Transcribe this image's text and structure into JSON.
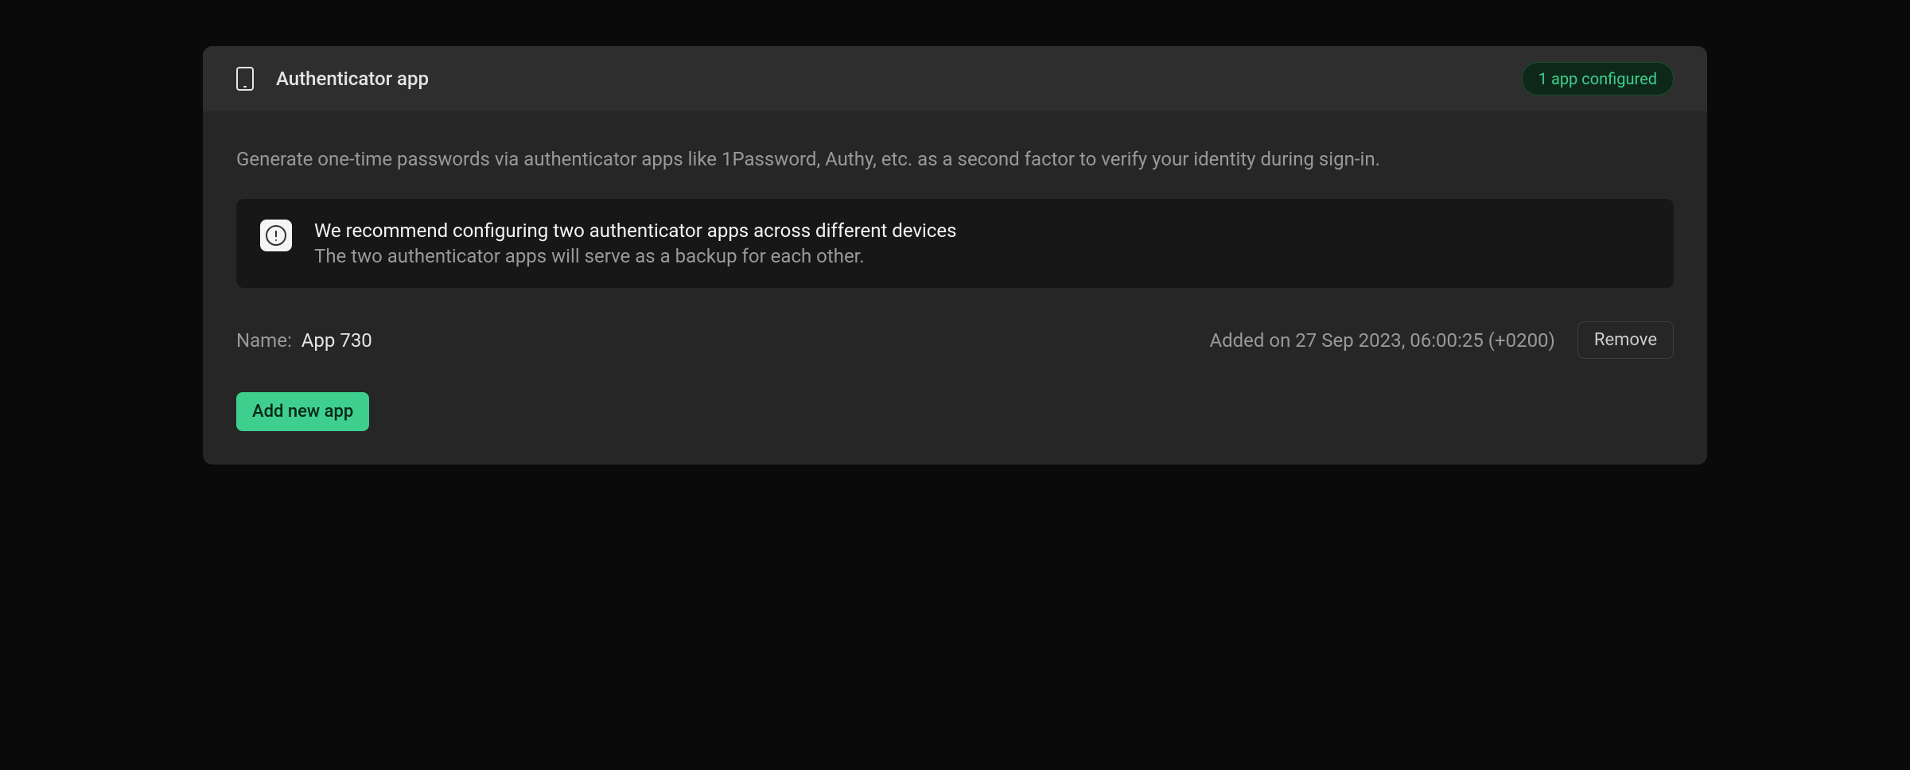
{
  "header": {
    "title": "Authenticator app",
    "badge": "1 app configured"
  },
  "description": "Generate one-time passwords via authenticator apps like 1Password, Authy, etc. as a second factor to verify your identity during sign-in.",
  "notice": {
    "title": "We recommend configuring two authenticator apps across different devices",
    "subtitle": "The two authenticator apps will serve as a backup for each other."
  },
  "app": {
    "name_label": "Name:",
    "name_value": "App 730",
    "added_date": "Added on 27 Sep 2023, 06:00:25 (+0200)",
    "remove_label": "Remove"
  },
  "add_button": "Add new app"
}
